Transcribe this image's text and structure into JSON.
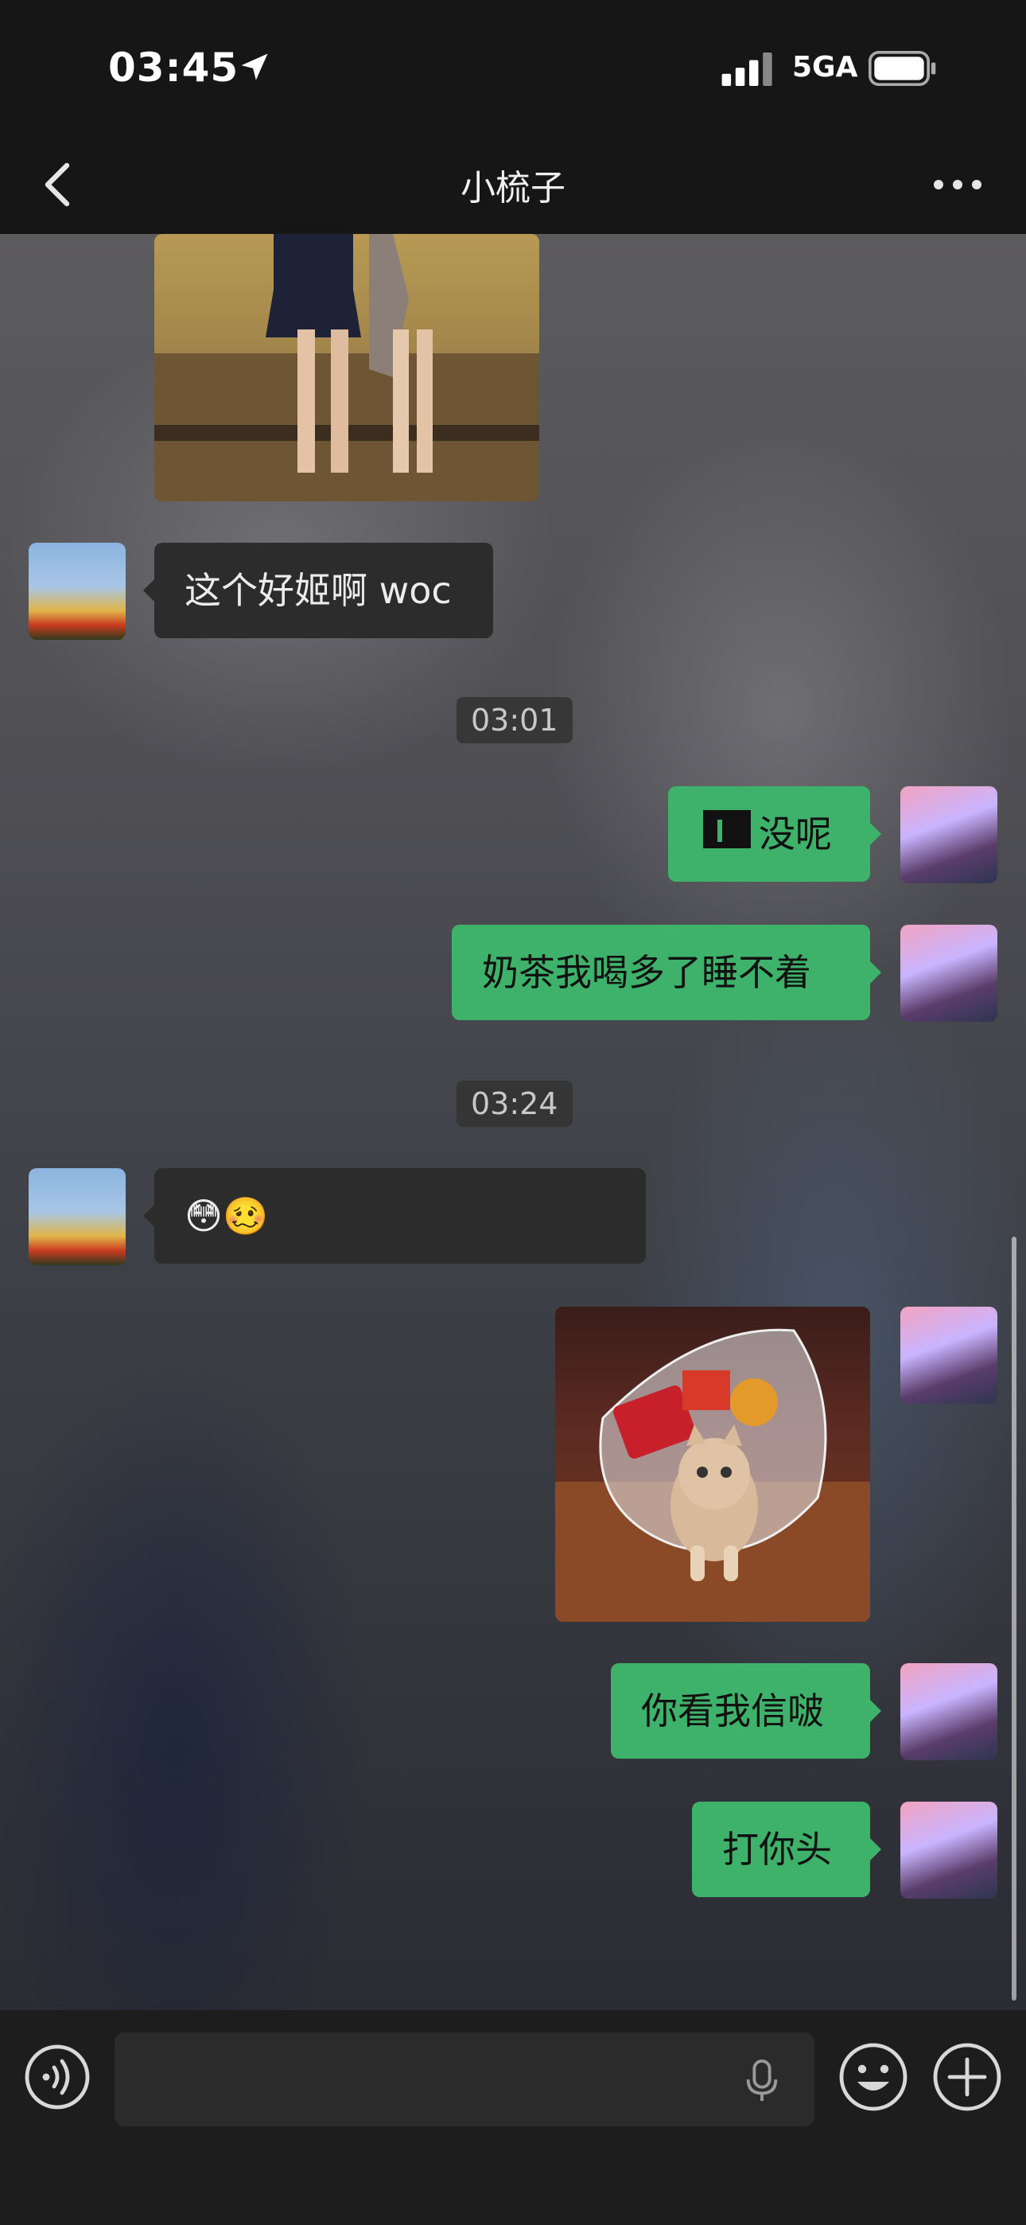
{
  "status_bar": {
    "time": "03:45",
    "network": "5GA"
  },
  "header": {
    "title": "小梳子"
  },
  "messages": {
    "m1": "这个好姬啊 woc",
    "t1": "03:01",
    "m2": "没呢",
    "m3": "奶茶我喝多了睡不着",
    "t2": "03:24",
    "m4": "😳🥴",
    "m5": "你看我信啵",
    "m6": "打你头"
  },
  "input_bar": {
    "placeholder": ""
  },
  "colors": {
    "outgoing_bubble": "#3eb26a",
    "incoming_bubble": "#2c2c2c",
    "background": "#1b1b1b"
  }
}
